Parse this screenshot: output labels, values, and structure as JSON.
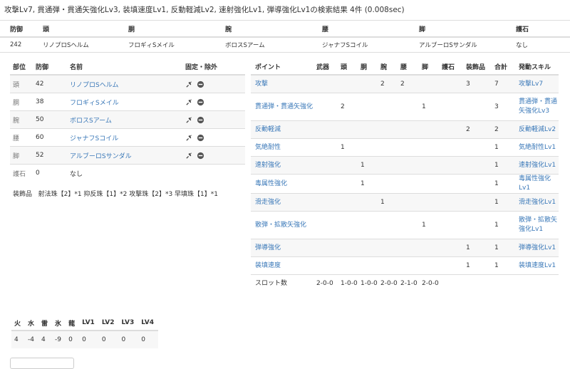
{
  "title": "攻撃Lv7, 貫通弾・貫通矢強化Lv3, 装填速度Lv1, 反動軽減Lv2, 速射強化Lv1, 弾導強化Lv1の検索結果 4件 (0.008sec)",
  "summary": {
    "headers": [
      "防御",
      "頭",
      "胴",
      "腕",
      "腰",
      "脚",
      "護石"
    ],
    "values": [
      "242",
      "リノプロSヘルム",
      "フロギィSメイル",
      "ボロスSアーム",
      "ジャナフSコイル",
      "アルブーロSサンダル",
      "なし"
    ]
  },
  "equipment": {
    "headers": [
      "部位",
      "防御",
      "名前",
      "固定・除外"
    ],
    "rows": [
      {
        "part": "頭",
        "defense": "42",
        "name": "リノプロSヘルム"
      },
      {
        "part": "胴",
        "defense": "38",
        "name": "フロギィSメイル"
      },
      {
        "part": "腕",
        "defense": "50",
        "name": "ボロスSアーム"
      },
      {
        "part": "腰",
        "defense": "60",
        "name": "ジャナフSコイル"
      },
      {
        "part": "脚",
        "defense": "52",
        "name": "アルブーロSサンダル"
      }
    ],
    "charm": {
      "part": "護石",
      "defense": "0",
      "name": "なし"
    },
    "icons": [
      "pin-icon",
      "minus-circle-icon"
    ]
  },
  "decorations": {
    "label": "装飾品",
    "value": "射法珠【2】*1 抑反珠【1】*2 攻撃珠【2】*3 早填珠【1】*1"
  },
  "skills": {
    "headers": [
      "ポイント",
      "武器",
      "頭",
      "胴",
      "腕",
      "腰",
      "脚",
      "護石",
      "装飾品",
      "合計",
      "発動スキル"
    ],
    "rows": [
      {
        "point": "攻撃",
        "weapon": "",
        "head": "",
        "body": "",
        "arms": "2",
        "waist": "2",
        "legs": "",
        "charm": "",
        "deco": "3",
        "total": "7",
        "skill": "攻撃Lv7"
      },
      {
        "point": "貫通弾・貫通矢強化",
        "weapon": "",
        "head": "2",
        "body": "",
        "arms": "",
        "waist": "",
        "legs": "1",
        "charm": "",
        "deco": "",
        "total": "3",
        "skill": "貫通弾・貫通矢強化Lv3"
      },
      {
        "point": "反動軽減",
        "weapon": "",
        "head": "",
        "body": "",
        "arms": "",
        "waist": "",
        "legs": "",
        "charm": "",
        "deco": "2",
        "total": "2",
        "skill": "反動軽減Lv2"
      },
      {
        "point": "気絶耐性",
        "weapon": "",
        "head": "1",
        "body": "",
        "arms": "",
        "waist": "",
        "legs": "",
        "charm": "",
        "deco": "",
        "total": "1",
        "skill": "気絶耐性Lv1"
      },
      {
        "point": "速射強化",
        "weapon": "",
        "head": "",
        "body": "1",
        "arms": "",
        "waist": "",
        "legs": "",
        "charm": "",
        "deco": "",
        "total": "1",
        "skill": "速射強化Lv1"
      },
      {
        "point": "毒属性強化",
        "weapon": "",
        "head": "",
        "body": "1",
        "arms": "",
        "waist": "",
        "legs": "",
        "charm": "",
        "deco": "",
        "total": "1",
        "skill": "毒属性強化Lv1"
      },
      {
        "point": "滑走強化",
        "weapon": "",
        "head": "",
        "body": "",
        "arms": "1",
        "waist": "",
        "legs": "",
        "charm": "",
        "deco": "",
        "total": "1",
        "skill": "滑走強化Lv1"
      },
      {
        "point": "散弾・拡散矢強化",
        "weapon": "",
        "head": "",
        "body": "",
        "arms": "",
        "waist": "",
        "legs": "1",
        "charm": "",
        "deco": "",
        "total": "1",
        "skill": "散弾・拡散矢強化Lv1"
      },
      {
        "point": "弾導強化",
        "weapon": "",
        "head": "",
        "body": "",
        "arms": "",
        "waist": "",
        "legs": "",
        "charm": "",
        "deco": "1",
        "total": "1",
        "skill": "弾導強化Lv1"
      },
      {
        "point": "装填速度",
        "weapon": "",
        "head": "",
        "body": "",
        "arms": "",
        "waist": "",
        "legs": "",
        "charm": "",
        "deco": "1",
        "total": "1",
        "skill": "装填速度Lv1"
      }
    ],
    "slots": {
      "label": "スロット数",
      "values": [
        "2-0-0",
        "1-0-0",
        "1-0-0",
        "2-0-0",
        "2-1-0",
        "2-0-0"
      ]
    }
  },
  "resist": {
    "headers": [
      "火",
      "水",
      "雷",
      "氷",
      "龍",
      "LV1",
      "LV2",
      "LV3",
      "LV4"
    ],
    "values": [
      "4",
      "-4",
      "4",
      "-9",
      "0",
      "0",
      "0",
      "0",
      "0"
    ]
  },
  "colors": {
    "link": "#3a78b8",
    "border": "#dddddd",
    "stripe": "#f7f7f7"
  }
}
